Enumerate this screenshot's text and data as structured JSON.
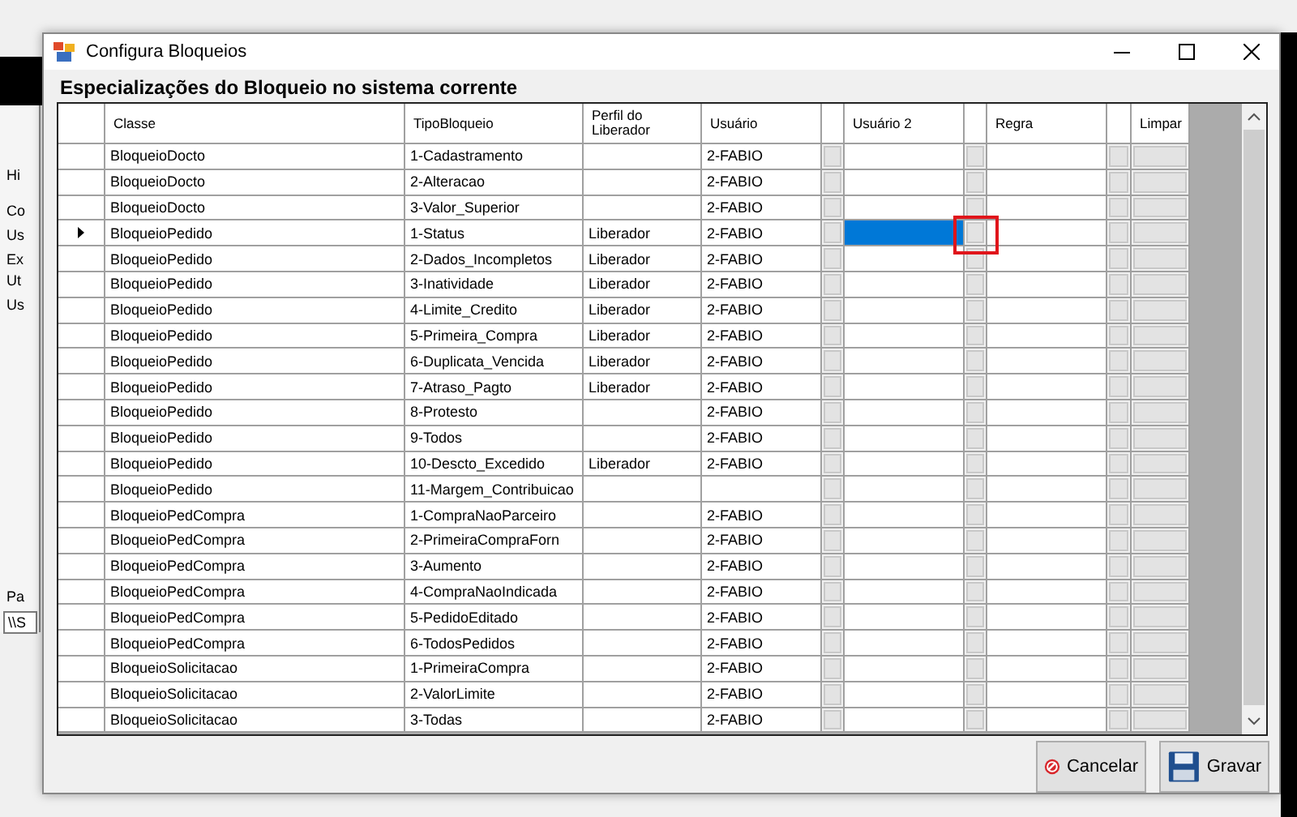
{
  "background_window": {
    "labels": [
      "Hi",
      "Co",
      "Us",
      "Ex",
      "Ut",
      "Us",
      "Pa"
    ],
    "path_value": "\\\\S"
  },
  "window": {
    "title": "Configura Bloqueios"
  },
  "heading": "Especializações do Bloqueio no sistema corrente",
  "table": {
    "columns": [
      "Classe",
      "TipoBloqueio",
      "Perfil do Liberador",
      "Usuário",
      "Usuário 2",
      "Regra",
      "Limpar"
    ],
    "rows": [
      {
        "classe": "BloqueioDocto",
        "tipo": "1-Cadastramento",
        "perfil": "",
        "usuario": "2-FABIO",
        "current": false,
        "marked": false
      },
      {
        "classe": "BloqueioDocto",
        "tipo": "2-Alteracao",
        "perfil": "",
        "usuario": "2-FABIO",
        "current": false,
        "marked": false
      },
      {
        "classe": "BloqueioDocto",
        "tipo": "3-Valor_Superior",
        "perfil": "",
        "usuario": "2-FABIO",
        "current": false,
        "marked": false
      },
      {
        "classe": "BloqueioPedido",
        "tipo": "1-Status",
        "perfil": "Liberador",
        "usuario": "2-FABIO",
        "current": true,
        "marked": true
      },
      {
        "classe": "BloqueioPedido",
        "tipo": "2-Dados_Incompletos",
        "perfil": "Liberador",
        "usuario": "2-FABIO",
        "current": false,
        "marked": false
      },
      {
        "classe": "BloqueioPedido",
        "tipo": "3-Inatividade",
        "perfil": "Liberador",
        "usuario": "2-FABIO",
        "current": false,
        "marked": false
      },
      {
        "classe": "BloqueioPedido",
        "tipo": "4-Limite_Credito",
        "perfil": "Liberador",
        "usuario": "2-FABIO",
        "current": false,
        "marked": false
      },
      {
        "classe": "BloqueioPedido",
        "tipo": "5-Primeira_Compra",
        "perfil": "Liberador",
        "usuario": "2-FABIO",
        "current": false,
        "marked": false
      },
      {
        "classe": "BloqueioPedido",
        "tipo": "6-Duplicata_Vencida",
        "perfil": "Liberador",
        "usuario": "2-FABIO",
        "current": false,
        "marked": false
      },
      {
        "classe": "BloqueioPedido",
        "tipo": "7-Atraso_Pagto",
        "perfil": "Liberador",
        "usuario": "2-FABIO",
        "current": false,
        "marked": false
      },
      {
        "classe": "BloqueioPedido",
        "tipo": "8-Protesto",
        "perfil": "",
        "usuario": "2-FABIO",
        "current": false,
        "marked": false
      },
      {
        "classe": "BloqueioPedido",
        "tipo": "9-Todos",
        "perfil": "",
        "usuario": "2-FABIO",
        "current": false,
        "marked": false
      },
      {
        "classe": "BloqueioPedido",
        "tipo": "10-Descto_Excedido",
        "perfil": "Liberador",
        "usuario": "2-FABIO",
        "current": false,
        "marked": false
      },
      {
        "classe": "BloqueioPedido",
        "tipo": "11-Margem_Contribuicao",
        "perfil": "",
        "usuario": "",
        "current": false,
        "marked": false
      },
      {
        "classe": "BloqueioPedCompra",
        "tipo": "1-CompraNaoParceiro",
        "perfil": "",
        "usuario": "2-FABIO",
        "current": false,
        "marked": false
      },
      {
        "classe": "BloqueioPedCompra",
        "tipo": "2-PrimeiraCompraForn",
        "perfil": "",
        "usuario": "2-FABIO",
        "current": false,
        "marked": false
      },
      {
        "classe": "BloqueioPedCompra",
        "tipo": "3-Aumento",
        "perfil": "",
        "usuario": "2-FABIO",
        "current": false,
        "marked": false
      },
      {
        "classe": "BloqueioPedCompra",
        "tipo": "4-CompraNaoIndicada",
        "perfil": "",
        "usuario": "2-FABIO",
        "current": false,
        "marked": false
      },
      {
        "classe": "BloqueioPedCompra",
        "tipo": "5-PedidoEditado",
        "perfil": "",
        "usuario": "2-FABIO",
        "current": false,
        "marked": false
      },
      {
        "classe": "BloqueioPedCompra",
        "tipo": "6-TodosPedidos",
        "perfil": "",
        "usuario": "2-FABIO",
        "current": false,
        "marked": false
      },
      {
        "classe": "BloqueioSolicitacao",
        "tipo": "1-PrimeiraCompra",
        "perfil": "",
        "usuario": "2-FABIO",
        "current": false,
        "marked": false
      },
      {
        "classe": "BloqueioSolicitacao",
        "tipo": "2-ValorLimite",
        "perfil": "",
        "usuario": "2-FABIO",
        "current": false,
        "marked": false
      },
      {
        "classe": "BloqueioSolicitacao",
        "tipo": "3-Todas",
        "perfil": "",
        "usuario": "2-FABIO",
        "current": false,
        "marked": false
      }
    ]
  },
  "buttons": [
    {
      "label": "Cancelar",
      "kind": "cancel"
    },
    {
      "label": "Gravar",
      "kind": "save"
    }
  ]
}
